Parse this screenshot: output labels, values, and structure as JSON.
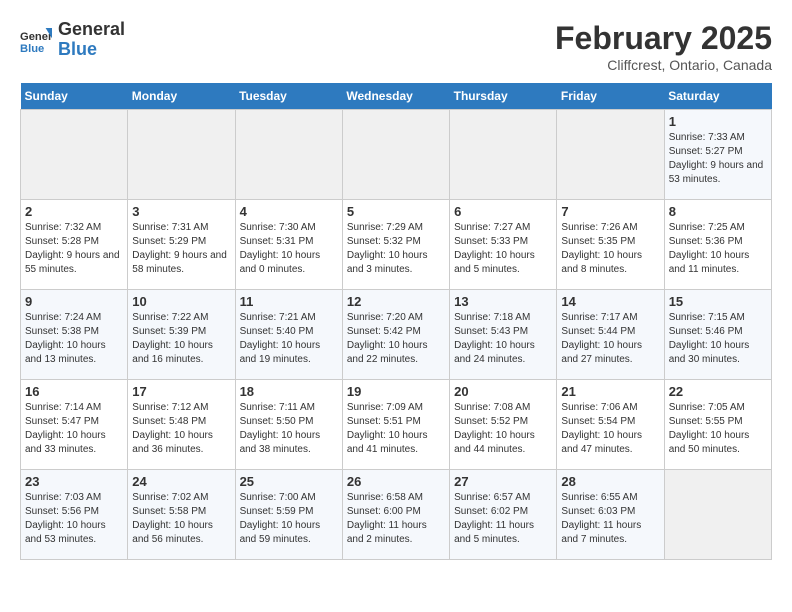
{
  "header": {
    "logo_line1": "General",
    "logo_line2": "Blue",
    "title": "February 2025",
    "subtitle": "Cliffcrest, Ontario, Canada"
  },
  "weekdays": [
    "Sunday",
    "Monday",
    "Tuesday",
    "Wednesday",
    "Thursday",
    "Friday",
    "Saturday"
  ],
  "weeks": [
    [
      {
        "day": "",
        "info": ""
      },
      {
        "day": "",
        "info": ""
      },
      {
        "day": "",
        "info": ""
      },
      {
        "day": "",
        "info": ""
      },
      {
        "day": "",
        "info": ""
      },
      {
        "day": "",
        "info": ""
      },
      {
        "day": "1",
        "info": "Sunrise: 7:33 AM\nSunset: 5:27 PM\nDaylight: 9 hours and 53 minutes."
      }
    ],
    [
      {
        "day": "2",
        "info": "Sunrise: 7:32 AM\nSunset: 5:28 PM\nDaylight: 9 hours and 55 minutes."
      },
      {
        "day": "3",
        "info": "Sunrise: 7:31 AM\nSunset: 5:29 PM\nDaylight: 9 hours and 58 minutes."
      },
      {
        "day": "4",
        "info": "Sunrise: 7:30 AM\nSunset: 5:31 PM\nDaylight: 10 hours and 0 minutes."
      },
      {
        "day": "5",
        "info": "Sunrise: 7:29 AM\nSunset: 5:32 PM\nDaylight: 10 hours and 3 minutes."
      },
      {
        "day": "6",
        "info": "Sunrise: 7:27 AM\nSunset: 5:33 PM\nDaylight: 10 hours and 5 minutes."
      },
      {
        "day": "7",
        "info": "Sunrise: 7:26 AM\nSunset: 5:35 PM\nDaylight: 10 hours and 8 minutes."
      },
      {
        "day": "8",
        "info": "Sunrise: 7:25 AM\nSunset: 5:36 PM\nDaylight: 10 hours and 11 minutes."
      }
    ],
    [
      {
        "day": "9",
        "info": "Sunrise: 7:24 AM\nSunset: 5:38 PM\nDaylight: 10 hours and 13 minutes."
      },
      {
        "day": "10",
        "info": "Sunrise: 7:22 AM\nSunset: 5:39 PM\nDaylight: 10 hours and 16 minutes."
      },
      {
        "day": "11",
        "info": "Sunrise: 7:21 AM\nSunset: 5:40 PM\nDaylight: 10 hours and 19 minutes."
      },
      {
        "day": "12",
        "info": "Sunrise: 7:20 AM\nSunset: 5:42 PM\nDaylight: 10 hours and 22 minutes."
      },
      {
        "day": "13",
        "info": "Sunrise: 7:18 AM\nSunset: 5:43 PM\nDaylight: 10 hours and 24 minutes."
      },
      {
        "day": "14",
        "info": "Sunrise: 7:17 AM\nSunset: 5:44 PM\nDaylight: 10 hours and 27 minutes."
      },
      {
        "day": "15",
        "info": "Sunrise: 7:15 AM\nSunset: 5:46 PM\nDaylight: 10 hours and 30 minutes."
      }
    ],
    [
      {
        "day": "16",
        "info": "Sunrise: 7:14 AM\nSunset: 5:47 PM\nDaylight: 10 hours and 33 minutes."
      },
      {
        "day": "17",
        "info": "Sunrise: 7:12 AM\nSunset: 5:48 PM\nDaylight: 10 hours and 36 minutes."
      },
      {
        "day": "18",
        "info": "Sunrise: 7:11 AM\nSunset: 5:50 PM\nDaylight: 10 hours and 38 minutes."
      },
      {
        "day": "19",
        "info": "Sunrise: 7:09 AM\nSunset: 5:51 PM\nDaylight: 10 hours and 41 minutes."
      },
      {
        "day": "20",
        "info": "Sunrise: 7:08 AM\nSunset: 5:52 PM\nDaylight: 10 hours and 44 minutes."
      },
      {
        "day": "21",
        "info": "Sunrise: 7:06 AM\nSunset: 5:54 PM\nDaylight: 10 hours and 47 minutes."
      },
      {
        "day": "22",
        "info": "Sunrise: 7:05 AM\nSunset: 5:55 PM\nDaylight: 10 hours and 50 minutes."
      }
    ],
    [
      {
        "day": "23",
        "info": "Sunrise: 7:03 AM\nSunset: 5:56 PM\nDaylight: 10 hours and 53 minutes."
      },
      {
        "day": "24",
        "info": "Sunrise: 7:02 AM\nSunset: 5:58 PM\nDaylight: 10 hours and 56 minutes."
      },
      {
        "day": "25",
        "info": "Sunrise: 7:00 AM\nSunset: 5:59 PM\nDaylight: 10 hours and 59 minutes."
      },
      {
        "day": "26",
        "info": "Sunrise: 6:58 AM\nSunset: 6:00 PM\nDaylight: 11 hours and 2 minutes."
      },
      {
        "day": "27",
        "info": "Sunrise: 6:57 AM\nSunset: 6:02 PM\nDaylight: 11 hours and 5 minutes."
      },
      {
        "day": "28",
        "info": "Sunrise: 6:55 AM\nSunset: 6:03 PM\nDaylight: 11 hours and 7 minutes."
      },
      {
        "day": "",
        "info": ""
      }
    ]
  ]
}
